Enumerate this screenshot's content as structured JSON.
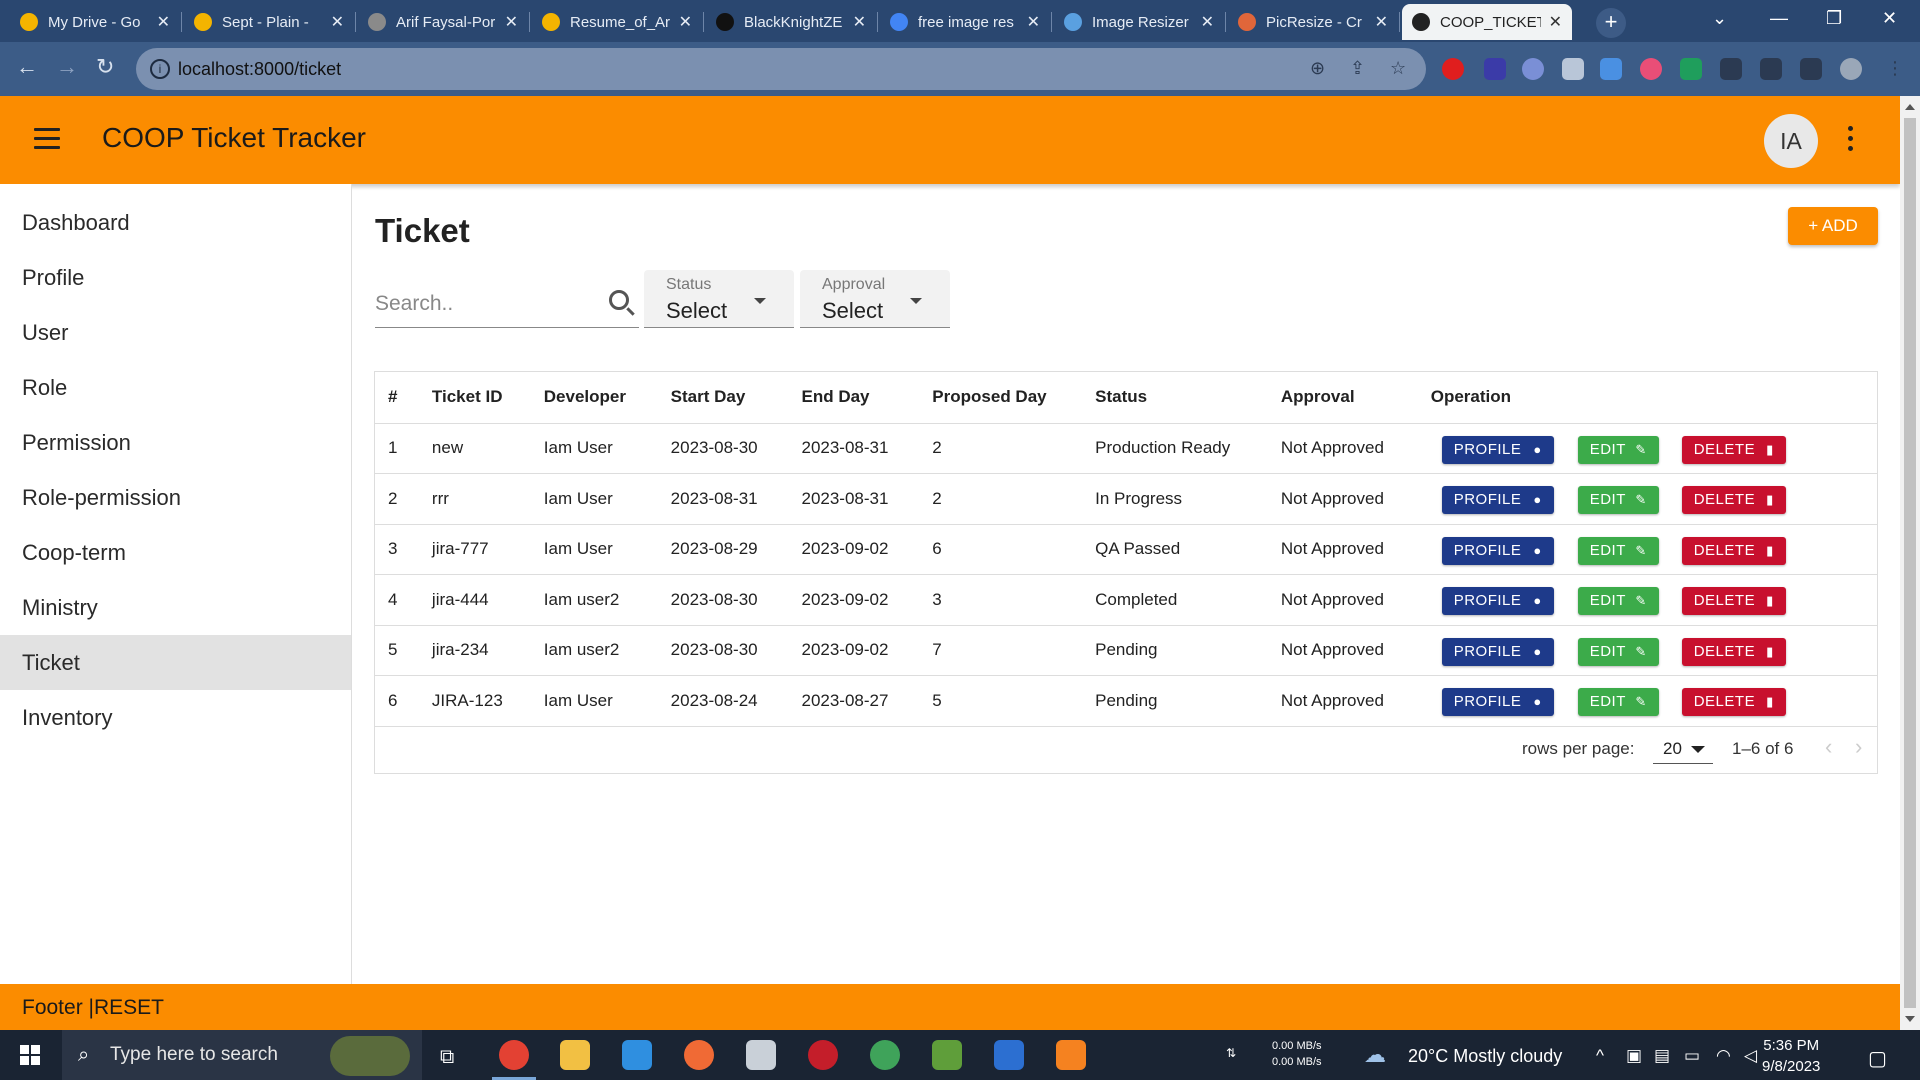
{
  "browser": {
    "tabs": [
      {
        "title": "My Drive - Go",
        "icon": "google-drive-icon",
        "color": "#f4b400"
      },
      {
        "title": "Sept - Plain -",
        "icon": "google-drive-icon",
        "color": "#f4b400"
      },
      {
        "title": "Arif Faysal-Por",
        "icon": "globe-icon",
        "color": "#8a8a8a"
      },
      {
        "title": "Resume_of_Ar",
        "icon": "google-drive-icon",
        "color": "#f4b400"
      },
      {
        "title": "BlackKnightZE",
        "icon": "github-icon",
        "color": "#111111"
      },
      {
        "title": "free image res",
        "icon": "google-icon",
        "color": "#4285f4"
      },
      {
        "title": "Image Resizer",
        "icon": "image-resizer-icon",
        "color": "#5aa0e0"
      },
      {
        "title": "PicResize - Cr",
        "icon": "picresize-icon",
        "color": "#e0663a"
      },
      {
        "title": "COOP_TICKET",
        "icon": "panda-icon",
        "color": "#222222",
        "active": true
      }
    ],
    "url": "localhost:8000/ticket"
  },
  "app": {
    "title": "COOP Ticket Tracker",
    "avatar_initials": "IA",
    "accent": "#fb8c00"
  },
  "sidebar": {
    "items": [
      {
        "label": "Dashboard"
      },
      {
        "label": "Profile"
      },
      {
        "label": "User"
      },
      {
        "label": "Role"
      },
      {
        "label": "Permission"
      },
      {
        "label": "Role-permission"
      },
      {
        "label": "Coop-term"
      },
      {
        "label": "Ministry"
      },
      {
        "label": "Ticket",
        "active": true
      },
      {
        "label": "Inventory"
      }
    ]
  },
  "page": {
    "title": "Ticket",
    "add_label": "+ ADD",
    "search_placeholder": "Search..",
    "status_filter": {
      "label": "Status",
      "value": "Select"
    },
    "approval_filter": {
      "label": "Approval",
      "value": "Select"
    }
  },
  "table": {
    "columns": [
      "#",
      "Ticket ID",
      "Developer",
      "Start Day",
      "End Day",
      "Proposed Day",
      "Status",
      "Approval",
      "Operation"
    ],
    "rows": [
      {
        "n": "1",
        "id": "new",
        "dev": "Iam User",
        "start": "2023-08-30",
        "end": "2023-08-31",
        "days": "2",
        "status": "Production Ready",
        "approval": "Not Approved"
      },
      {
        "n": "2",
        "id": "rrr",
        "dev": "Iam User",
        "start": "2023-08-31",
        "end": "2023-08-31",
        "days": "2",
        "status": "In Progress",
        "approval": "Not Approved"
      },
      {
        "n": "3",
        "id": "jira-777",
        "dev": "Iam User",
        "start": "2023-08-29",
        "end": "2023-09-02",
        "days": "6",
        "status": "QA Passed",
        "approval": "Not Approved"
      },
      {
        "n": "4",
        "id": "jira-444",
        "dev": "Iam user2",
        "start": "2023-08-30",
        "end": "2023-09-02",
        "days": "3",
        "status": "Completed",
        "approval": "Not Approved"
      },
      {
        "n": "5",
        "id": "jira-234",
        "dev": "Iam user2",
        "start": "2023-08-30",
        "end": "2023-09-02",
        "days": "7",
        "status": "Pending",
        "approval": "Not Approved"
      },
      {
        "n": "6",
        "id": "JIRA-123",
        "dev": "Iam User",
        "start": "2023-08-24",
        "end": "2023-08-27",
        "days": "5",
        "status": "Pending",
        "approval": "Not Approved"
      }
    ],
    "actions": {
      "profile": "PROFILE",
      "edit": "EDIT",
      "delete": "DELETE"
    },
    "rows_per_page_label": "rows per page:",
    "rows_per_page": "20",
    "range": "1–6 of 6"
  },
  "footer": {
    "text": "Footer |RESET"
  },
  "taskbar": {
    "search_placeholder": "Type here to search",
    "net_up": "0.00 MB/s",
    "net_down": "0.00 MB/s",
    "weather": "20°C  Mostly cloudy",
    "time": "5:36 PM",
    "date": "9/8/2023"
  }
}
